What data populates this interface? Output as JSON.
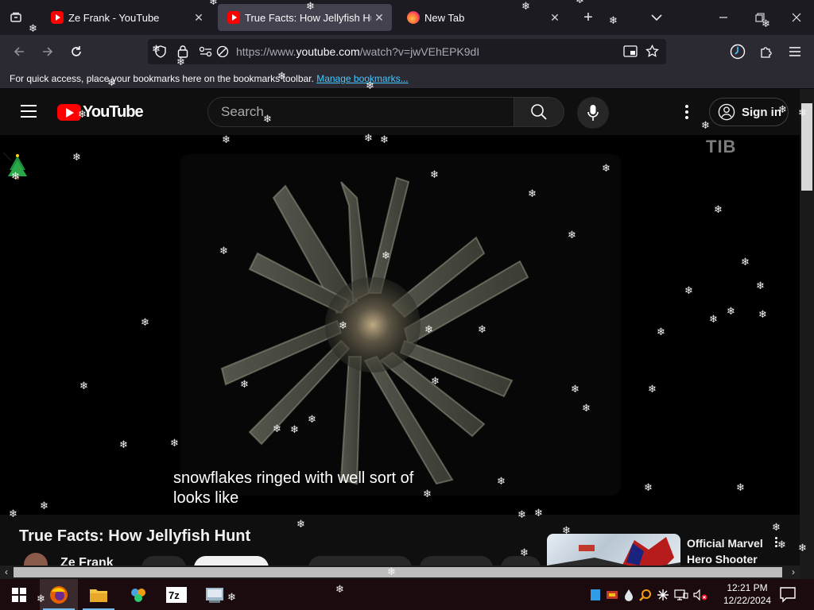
{
  "browser": {
    "tabs": [
      {
        "title": "Ze Frank - YouTube",
        "favicon": "youtube-favicon-icon",
        "active": false
      },
      {
        "title": "True Facts: How Jellyfish Hunt",
        "favicon": "youtube-favicon-icon",
        "active": true
      },
      {
        "title": "New Tab",
        "favicon": "firefox-favicon-icon",
        "active": false
      }
    ],
    "url": {
      "prefix": "https://www.",
      "domain": "youtube.com",
      "path": "/watch?v=jwVEhEPK9dI"
    },
    "bookmarks_bar": {
      "message": "For quick access, place your bookmarks here on the bookmarks toolbar.",
      "link": "Manage bookmarks..."
    }
  },
  "youtube": {
    "logo_text": "YouTube",
    "search_placeholder": "Search",
    "sign_in_label": "Sign in",
    "watermark": "TIB",
    "caption": "snowflakes ringed with well sort of\nlooks like",
    "video_title": "True Facts: How Jellyfish Hunt",
    "channel_name": "Ze Frank",
    "recommended": {
      "title": "Official Marvel Hero Shooter"
    }
  },
  "taskbar": {
    "clock_time": "12:21 PM",
    "clock_date": "12/22/2024",
    "apps": [
      "start-icon",
      "firefox-icon",
      "file-explorer-icon",
      "paint-icon",
      "7zip-icon",
      "control-panel-icon"
    ]
  },
  "colors": {
    "tab_strip": "#1c1b22",
    "toolbar": "#2b2a33",
    "youtube_red": "#ff0000",
    "link": "#45c8ff",
    "taskbar": "#1b0b0e"
  }
}
